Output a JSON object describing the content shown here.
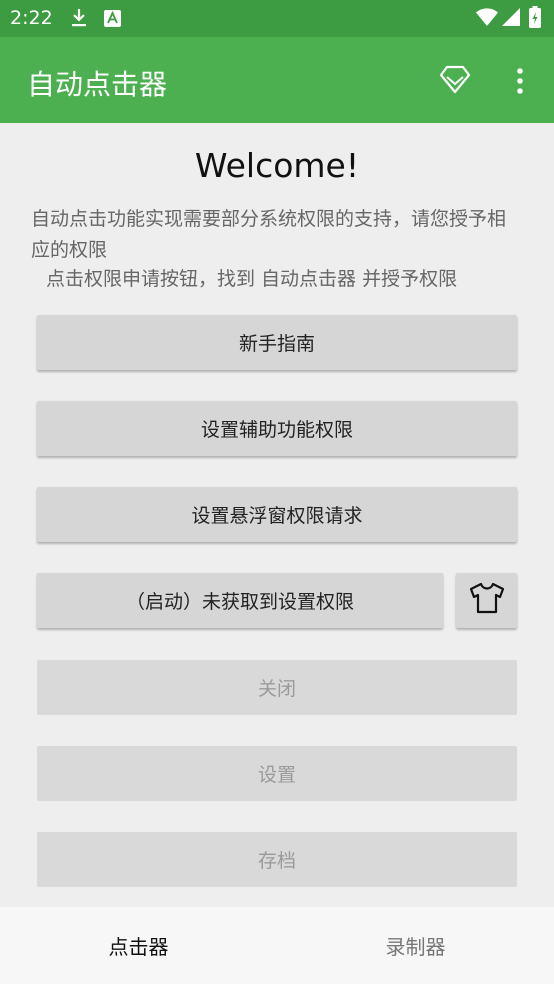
{
  "status_bar": {
    "time": "2:22",
    "icons": [
      "download-icon",
      "font-a-icon",
      "wifi-icon",
      "signal-icon",
      "battery-icon"
    ]
  },
  "toolbar": {
    "title": "自动点击器",
    "color": "#4caf50",
    "actions": [
      "diamond-icon",
      "more-vert-icon"
    ]
  },
  "content": {
    "welcome": "Welcome!",
    "description": "自动点击功能实现需要部分系统权限的支持，请您授予相应的权限",
    "hint": "点击权限申请按钮，找到 自动点击器 并授予权限",
    "buttons": {
      "guide": "新手指南",
      "accessibility": "设置辅助功能权限",
      "overlay": "设置悬浮窗权限请求",
      "start": "（启动）未获取到设置权限",
      "close": "关闭",
      "settings": "设置",
      "save": "存档"
    },
    "skin_button_icon": "tshirt-icon"
  },
  "bottom_nav": {
    "items": [
      {
        "label": "点击器",
        "active": true
      },
      {
        "label": "录制器",
        "active": false
      }
    ]
  }
}
